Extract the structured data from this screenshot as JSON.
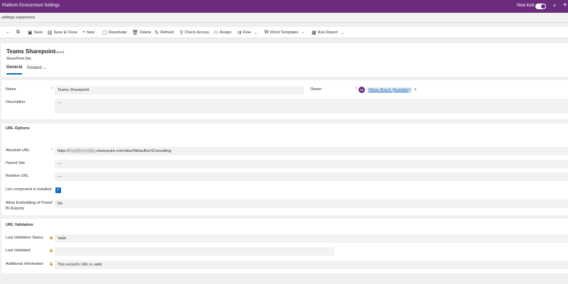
{
  "topbar": {
    "title": "Platform Environment Settings",
    "new_look_label": "New look",
    "new_look_on": true
  },
  "subbar": {
    "breadcrumb": "settings experience"
  },
  "commands": {
    "save": "Save",
    "save_close": "Save & Close",
    "new": "New",
    "deactivate": "Deactivate",
    "delete": "Delete",
    "refresh": "Refresh",
    "check_access": "Check Access",
    "assign": "Assign",
    "flow": "Flow",
    "word_templates": "Word Templates",
    "run_report": "Run Report"
  },
  "record": {
    "title": "Teams Sharepoint",
    "saved_status": "- Saved",
    "entity": "SharePoint Site",
    "tabs": {
      "general": "General",
      "related": "Related"
    }
  },
  "general": {
    "name_label": "Name",
    "name_value": "Teams Sharepoint",
    "owner_label": "Owner",
    "owner_value": "Niklas Bösch (Available)",
    "owner_initials": "NB",
    "description_label": "Description",
    "description_value": "---"
  },
  "url_options": {
    "title": "URL Options",
    "absolute_url_label": "Absolute URL",
    "absolute_url_prefix": "https://",
    "absolute_url_blurred": "hiaadfcrrsultiiig",
    "absolute_url_suffix": ".sharepoint.com/sites/NiklasBschConsulting",
    "parent_site_label": "Parent Site",
    "parent_site_value": "---",
    "relative_url_label": "Relative URL",
    "relative_url_value": "---",
    "list_component_label": "List component is installed",
    "list_component_checked": true,
    "allow_embedding_label_1": "Allow Embedding of Power",
    "allow_embedding_label_2": "BI Reports",
    "allow_embedding_value": "No"
  },
  "url_validation": {
    "title": "URL Validation",
    "last_status_label": "Last Validation Status",
    "last_status_value": "Valid",
    "last_validated_label": "Last Validated",
    "last_validated_value": "",
    "additional_info_label": "Additional Information",
    "additional_info_value": "This record's URL is valid."
  },
  "colors": {
    "topbar": "#6b2c7d",
    "accent": "#0f6cbd",
    "required": "#a4262c",
    "field_bg": "#f3f2f1"
  },
  "icons": [
    "search-icon",
    "plus-icon",
    "back-icon",
    "popout-icon",
    "save-icon",
    "save-close-icon",
    "new-icon",
    "deactivate-icon",
    "delete-icon",
    "refresh-icon",
    "check-access-icon",
    "assign-icon",
    "flow-icon",
    "word-templates-icon",
    "run-report-icon",
    "chevron-down-icon",
    "lock-icon",
    "close-icon",
    "checkmark-icon"
  ]
}
